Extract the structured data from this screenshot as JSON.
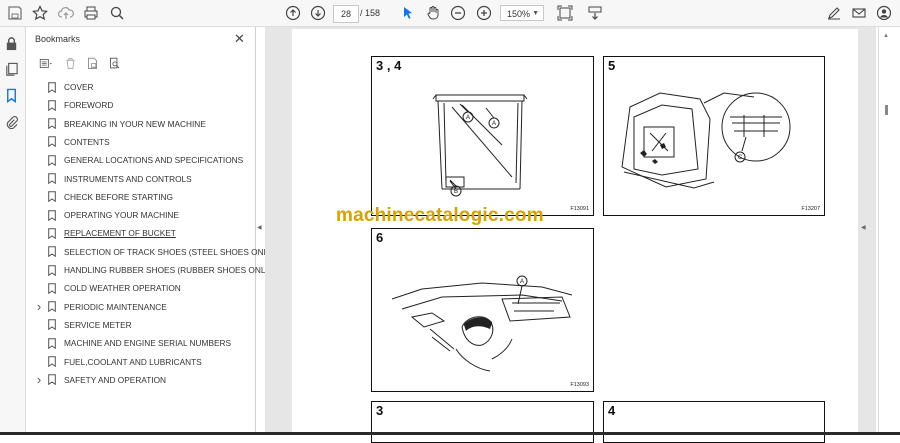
{
  "toolbar": {
    "page_current": "28",
    "page_total": "/ 158",
    "zoom": "150%"
  },
  "bookmarks": {
    "title": "Bookmarks",
    "items": [
      {
        "label": "COVER",
        "expandable": false,
        "underlined": false
      },
      {
        "label": "FOREWORD",
        "expandable": false,
        "underlined": false
      },
      {
        "label": "BREAKING IN YOUR NEW MACHINE",
        "expandable": false,
        "underlined": false
      },
      {
        "label": "CONTENTS",
        "expandable": false,
        "underlined": false
      },
      {
        "label": "GENERAL LOCATIONS AND SPECIFICATIONS",
        "expandable": false,
        "underlined": false
      },
      {
        "label": "INSTRUMENTS AND CONTROLS",
        "expandable": false,
        "underlined": false
      },
      {
        "label": "CHECK BEFORE STARTING",
        "expandable": false,
        "underlined": false
      },
      {
        "label": "OPERATING YOUR MACHINE",
        "expandable": false,
        "underlined": false
      },
      {
        "label": "REPLACEMENT OF BUCKET",
        "expandable": false,
        "underlined": true
      },
      {
        "label": "SELECTION OF TRACK SHOES (STEEL SHOES ONLY)",
        "expandable": false,
        "underlined": false
      },
      {
        "label": "HANDLING RUBBER SHOES (RUBBER SHOES ONLY)",
        "expandable": false,
        "underlined": false
      },
      {
        "label": "COLD WEATHER OPERATION",
        "expandable": false,
        "underlined": false
      },
      {
        "label": "PERIODIC MAINTENANCE",
        "expandable": true,
        "underlined": false
      },
      {
        "label": "SERVICE METER",
        "expandable": false,
        "underlined": false
      },
      {
        "label": "MACHINE AND ENGINE SERIAL NUMBERS",
        "expandable": false,
        "underlined": false
      },
      {
        "label": "FUEL,COOLANT AND LUBRICANTS",
        "expandable": false,
        "underlined": false
      },
      {
        "label": "SAFETY AND OPERATION",
        "expandable": true,
        "underlined": false
      }
    ]
  },
  "document": {
    "watermark": "machinecatalogic.com",
    "figures": [
      {
        "number": "3 , 4",
        "code": "F13091",
        "callouts": [
          "A",
          "A",
          "B"
        ]
      },
      {
        "number": "5",
        "code": "F13207",
        "callouts": [
          "C"
        ]
      },
      {
        "number": "6",
        "code": "F13093",
        "callouts": [
          "A"
        ]
      },
      {
        "number": "3",
        "code": "",
        "callouts": []
      },
      {
        "number": "4",
        "code": "",
        "callouts": []
      }
    ]
  },
  "colors": {
    "accent": "#1473e6",
    "watermark": "#d4a300",
    "doc_background": "#e6e6e6"
  }
}
